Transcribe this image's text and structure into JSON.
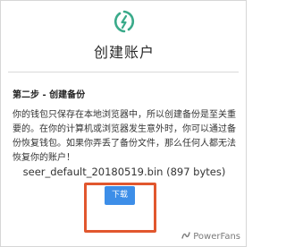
{
  "header": {
    "title": "创建账户",
    "logo_icon": "wallet-logo-icon",
    "logo_color": "#3aaa8a"
  },
  "step": {
    "title": "第二步 - 创建备份",
    "description": "你的钱包只保存在本地浏览器中，所以创建备份是至关重要的。在你的计算机或浏览器发生意外时，你可以通过备份恢复钱包。如果你弄丢了备份文件，那么任何人都无法恢复你的账户！"
  },
  "backup_file": {
    "name": "seer_default_20180519.bin",
    "size": "(897 bytes)"
  },
  "actions": {
    "download_label": "下载",
    "button_color": "#3d8ee8",
    "highlight_color": "#e1572e"
  },
  "watermark": {
    "text": "PowerFans"
  }
}
